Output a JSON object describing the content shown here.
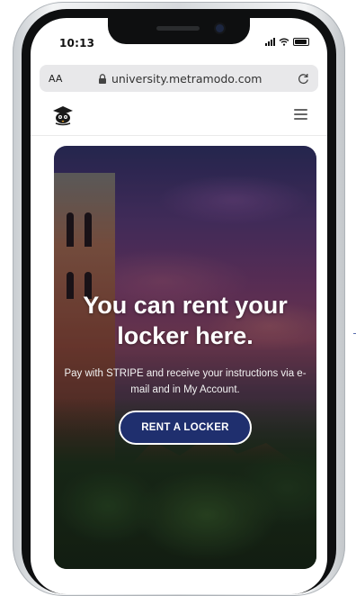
{
  "status_bar": {
    "time": "10:13"
  },
  "browser": {
    "text_size_label": "AA",
    "url": "university.metramodo.com"
  },
  "header": {
    "logo_icon": "mascot-logo-icon",
    "menu_icon": "hamburger-menu-icon"
  },
  "hero": {
    "title": "You can rent your locker here.",
    "subtitle": "Pay with STRIPE and receive your instructions via e-mail and in My Account.",
    "cta_label": "RENT A LOCKER"
  },
  "colors": {
    "cta_background": "#1f2f6e",
    "hero_text": "#ffffff",
    "address_bar": "#e8e8ea"
  }
}
